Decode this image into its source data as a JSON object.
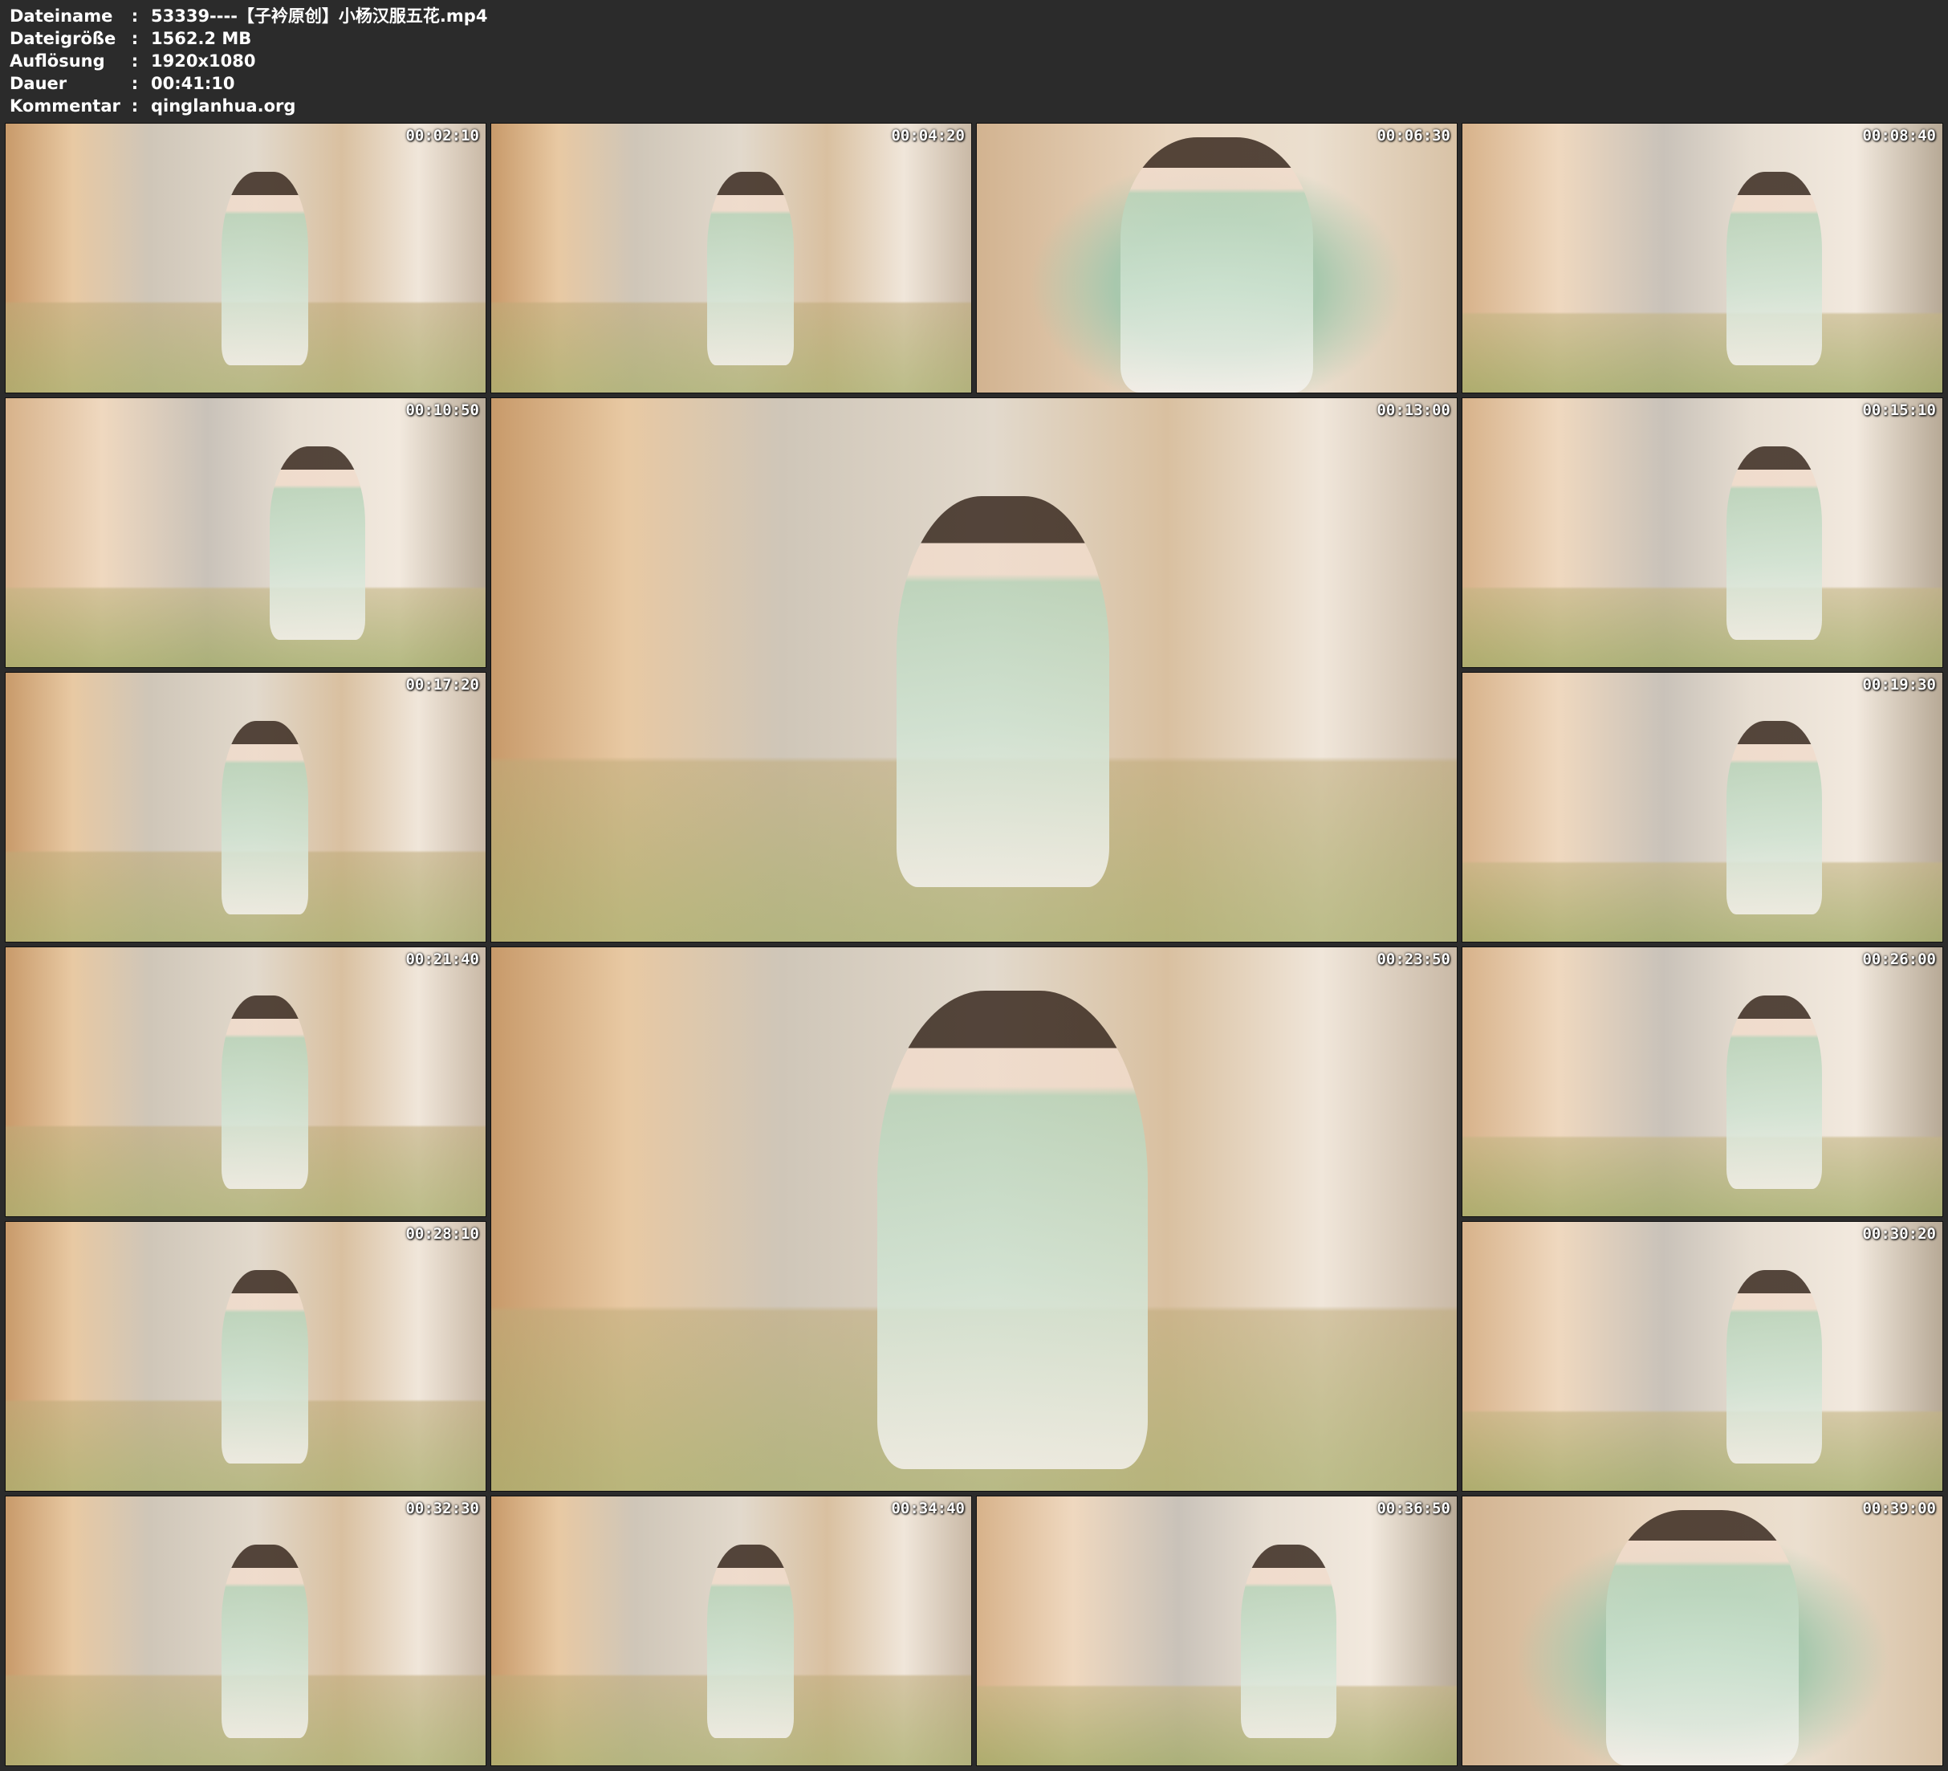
{
  "header": {
    "rows": [
      {
        "key": "Dateiname",
        "sep": ":",
        "value": "53339----【子衿原创】小杨汉服五花.mp4"
      },
      {
        "key": "Dateigröße",
        "sep": ":",
        "value": "1562.2 MB"
      },
      {
        "key": "Auflösung",
        "sep": ":",
        "value": "1920x1080"
      },
      {
        "key": "Dauer",
        "sep": ":",
        "value": "00:41:10"
      },
      {
        "key": "Kommentar",
        "sep": ":",
        "value": "qinglanhua.org"
      }
    ]
  },
  "thumbnails": [
    {
      "timestamp": "00:02:10"
    },
    {
      "timestamp": "00:04:20"
    },
    {
      "timestamp": "00:06:30"
    },
    {
      "timestamp": "00:08:40"
    },
    {
      "timestamp": "00:10:50"
    },
    {
      "timestamp": "00:13:00"
    },
    {
      "timestamp": "00:15:10"
    },
    {
      "timestamp": "00:17:20"
    },
    {
      "timestamp": "00:19:30"
    },
    {
      "timestamp": "00:21:40"
    },
    {
      "timestamp": "00:23:50"
    },
    {
      "timestamp": "00:26:00"
    },
    {
      "timestamp": "00:28:10"
    },
    {
      "timestamp": "00:30:20"
    },
    {
      "timestamp": "00:32:30"
    },
    {
      "timestamp": "00:34:40"
    },
    {
      "timestamp": "00:36:50"
    },
    {
      "timestamp": "00:39:00"
    }
  ]
}
